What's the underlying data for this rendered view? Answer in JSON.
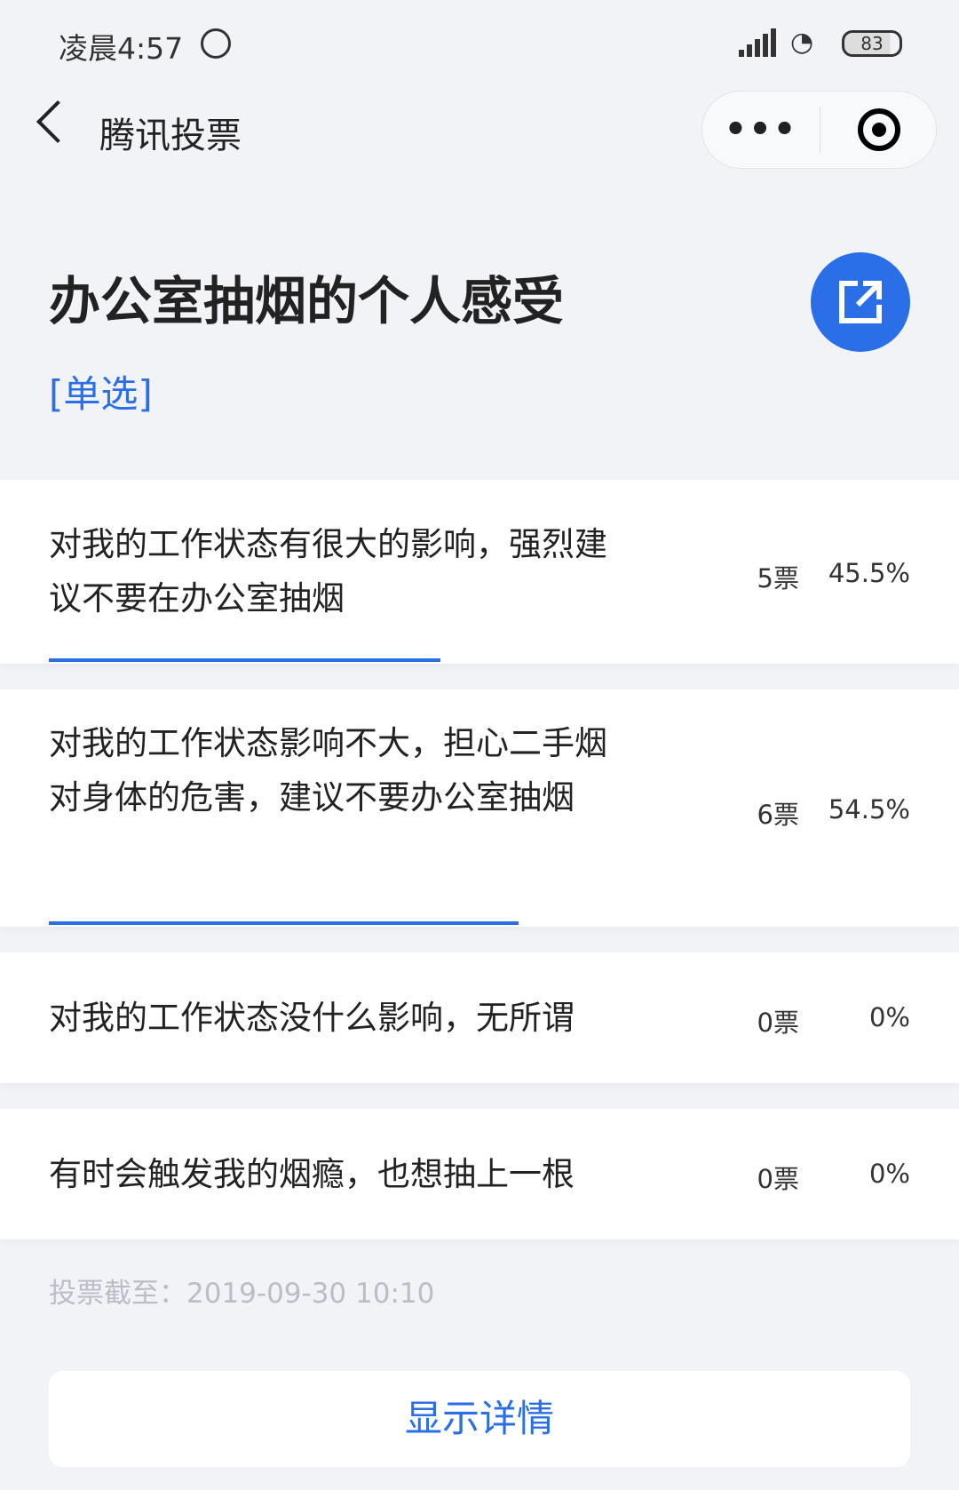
{
  "status_bar": {
    "time": "凌晨4:57",
    "battery": "83"
  },
  "nav": {
    "title": "腾讯投票",
    "more": "•••"
  },
  "poll": {
    "title": "办公室抽烟的个人感受",
    "type": "[单选]"
  },
  "options": [
    {
      "text": "对我的工作状态有很大的影响，强烈建议不要在办公室抽烟",
      "votes": "5票",
      "percent": "45.5%",
      "fill": 45.5
    },
    {
      "text": "对我的工作状态影响不大，担心二手烟对身体的危害，建议不要办公室抽烟",
      "votes": "6票",
      "percent": "54.5%",
      "fill": 54.5
    },
    {
      "text": "对我的工作状态没什么影响，无所谓",
      "votes": "0票",
      "percent": "0%",
      "fill": 0
    },
    {
      "text": "有时会触发我的烟瘾，也想抽上一根",
      "votes": "0票",
      "percent": "0%",
      "fill": 0
    }
  ],
  "deadline": "投票截至：2019-09-30 10:10",
  "details_button": "显示详情",
  "colors": {
    "accent": "#2a6ee8",
    "background": "#f2f3f7"
  }
}
